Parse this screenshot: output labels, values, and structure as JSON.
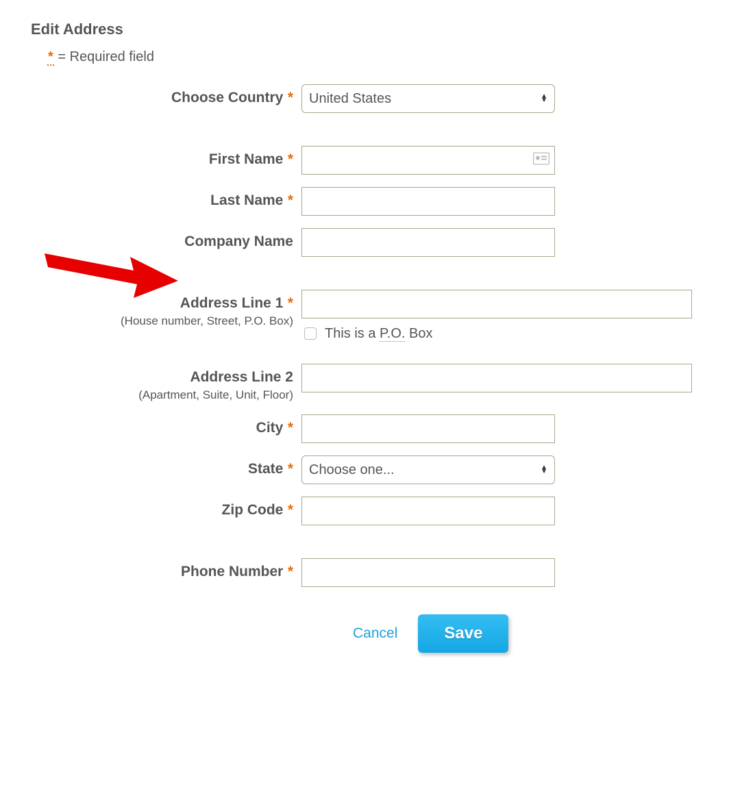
{
  "title": "Edit Address",
  "required_note_prefix": "*",
  "required_note_text": " = Required field",
  "labels": {
    "country": "Choose Country",
    "first_name": "First Name",
    "last_name": "Last Name",
    "company_name": "Company Name",
    "address1": "Address Line 1",
    "address1_hint": "(House number, Street, P.O. Box)",
    "po_box_prefix": "This is a ",
    "po_box_abbr": "P.O.",
    "po_box_suffix": " Box",
    "address2": "Address Line 2",
    "address2_hint": "(Apartment, Suite, Unit, Floor)",
    "city": "City",
    "state": "State",
    "zip": "Zip Code",
    "phone": "Phone Number"
  },
  "values": {
    "country": "United States",
    "first_name": "",
    "last_name": "",
    "company_name": "",
    "address1": "",
    "po_box_checked": false,
    "address2": "",
    "city": "",
    "state": "Choose one...",
    "zip": "",
    "phone": ""
  },
  "actions": {
    "cancel": "Cancel",
    "save": "Save"
  }
}
